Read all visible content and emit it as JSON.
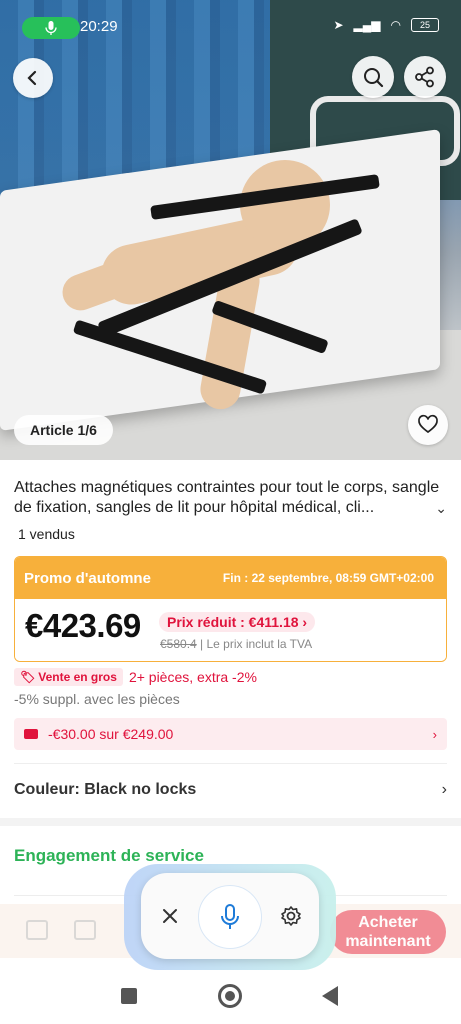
{
  "status_bar": {
    "time": "20:29",
    "battery": "25"
  },
  "gallery": {
    "counter": "Article 1/6"
  },
  "product": {
    "title": "Attaches magnétiques contraintes pour tout le corps, sangle de fixation, sangles de lit pour hôpital médical, cli...",
    "sold": "1 vendus"
  },
  "promo": {
    "name": "Promo d'automne",
    "end": "Fin :  22 septembre, 08:59 GMT+02:00",
    "price": "€423.69",
    "reduced": "Prix réduit : €411.18",
    "reduced_arrow": "›",
    "old_price": "€580.4",
    "tax_note": " | Le prix inclut la TVA"
  },
  "wholesale": {
    "tag": "Vente en gros",
    "text": "2+ pièces, extra -2%",
    "extra": "-5% suppl. avec les pièces"
  },
  "coupon": {
    "text": "-€30.00 sur €249.00",
    "arrow": "›"
  },
  "variant": {
    "label": "Couleur: Black no locks",
    "arrow": "›"
  },
  "service": {
    "title": "Engagement de service"
  },
  "buy": {
    "label": "Acheter maintenant"
  },
  "colors": {
    "accent_orange": "#f7b03b",
    "accent_red": "#e0133c",
    "accent_green": "#2db357",
    "mic_green": "#27c05a"
  }
}
